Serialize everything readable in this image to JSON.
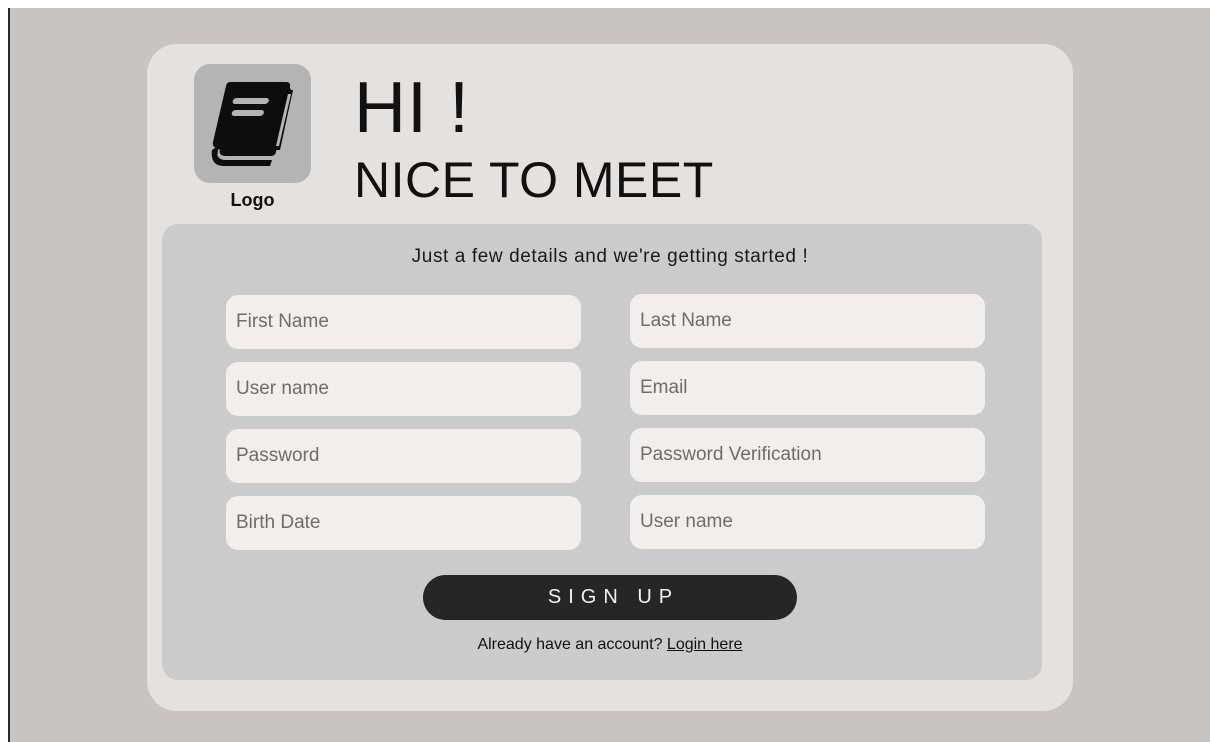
{
  "logo": {
    "icon": "book-icon",
    "label": "Logo"
  },
  "greeting": {
    "line1": "HI !",
    "line2": "NICE TO MEET"
  },
  "form": {
    "tagline": "Just a few details and we're getting started !",
    "fields": {
      "first_name": {
        "placeholder": "First Name",
        "value": ""
      },
      "last_name": {
        "placeholder": "Last Name",
        "value": ""
      },
      "user_name": {
        "placeholder": "User name",
        "value": ""
      },
      "email": {
        "placeholder": "Email",
        "value": ""
      },
      "password": {
        "placeholder": "Password",
        "value": ""
      },
      "password_verification": {
        "placeholder": "Password Verification",
        "value": ""
      },
      "birth_date": {
        "placeholder": "Birth Date",
        "value": ""
      },
      "user_name_2": {
        "placeholder": "User name",
        "value": ""
      }
    },
    "submit_label": "SIGN UP",
    "login_prompt": "Already have an account?",
    "login_link": "Login here"
  },
  "colors": {
    "background": "#c8c4c3",
    "card": "#e3e2e1",
    "panel": "#cbcbcb",
    "field": "#f1eeed",
    "button": "#262626",
    "logo_tile": "#b5b4b4"
  }
}
